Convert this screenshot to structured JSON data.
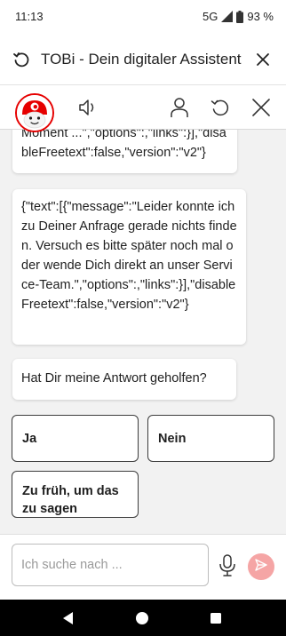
{
  "status": {
    "time": "11:13",
    "network": "5G",
    "battery": "93 %"
  },
  "app_bar": {
    "title": "TOBi - Dein digitaler Assistent",
    "reload_icon": "reload-icon",
    "close_icon": "close-icon"
  },
  "chat_header": {
    "avatar": "tobi-avatar",
    "icons": [
      "speaker-icon",
      "user-icon",
      "restart-icon",
      "close-icon"
    ],
    "accent": "#e60000"
  },
  "messages": [
    {
      "text": "Moment ...\",\"options\":,\"links\":}],\"disableFreetext\":false,\"version\":\"v2\"}"
    },
    {
      "text": "{\"text\":[{\"message\":\"Leider konnte ich zu Deiner Anfrage gerade nichts finden. Versuch es bitte später noch mal oder wende Dich direkt an unser Service-Team.\",\"options\":,\"links\":}],\"disableFreetext\":false,\"version\":\"v2\"}"
    },
    {
      "text": "Hat Dir meine Antwort geholfen?"
    }
  ],
  "options": [
    {
      "label": "Ja"
    },
    {
      "label": "Nein"
    },
    {
      "label": "Zu früh, um das zu sagen"
    }
  ],
  "input": {
    "placeholder": "Ich suche nach ...",
    "value": ""
  },
  "colors": {
    "send_button": "#f5a5a5",
    "chat_background": "#f2f2f2"
  }
}
